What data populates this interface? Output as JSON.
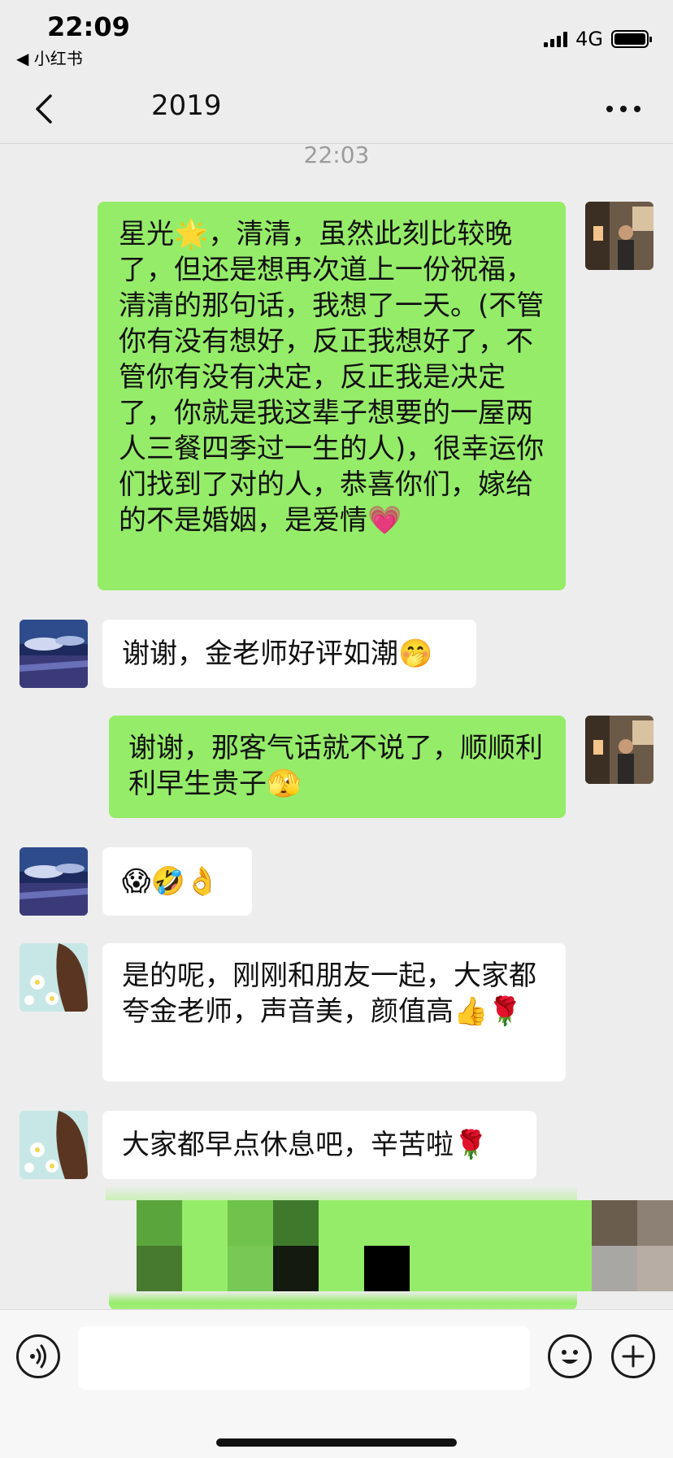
{
  "status_bar": {
    "time": "22:09",
    "back_app": "◀ 小红书",
    "network": "4G"
  },
  "nav": {
    "title": "2019"
  },
  "timestamp": "22:03",
  "messages": [
    {
      "side": "right",
      "text": "星光🌟，清清，虽然此刻比较晚了，但还是想再次道上一份祝福，清清的那句话，我想了一天。(不管你有没有想好，反正我想好了，不管你有没有决定，反正我是决定了，你就是我这辈子想要的一屋两人三餐四季过一生的人)，很幸运你们找到了对的人，恭喜你们，嫁给的不是婚姻，是爱情💗"
    },
    {
      "side": "left",
      "text": "谢谢，金老师好评如潮🤭"
    },
    {
      "side": "right",
      "text": "谢谢，那客气话就不说了，顺顺利利早生贵子🫣"
    },
    {
      "side": "left",
      "text": "😱🤣👌"
    },
    {
      "side": "left",
      "text": "是的呢，刚刚和朋友一起，大家都夸金老师，声音美，颜值高👍🌹"
    },
    {
      "side": "left",
      "text": "大家都早点休息吧，辛苦啦🌹"
    }
  ],
  "colors": {
    "bubble_green": "#95ec69",
    "bubble_white": "#ffffff",
    "background": "#ededed"
  },
  "icons": {
    "voice": "voice-icon",
    "emoji": "emoji-icon",
    "plus": "plus-icon",
    "back": "chevron-left-icon",
    "more": "more-icon"
  }
}
